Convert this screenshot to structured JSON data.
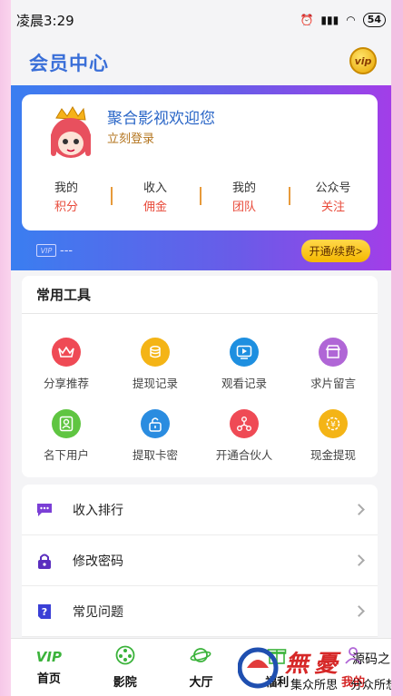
{
  "status": {
    "time": "凌晨3:29",
    "battery": "54"
  },
  "header": {
    "title": "会员中心",
    "vip_badge": "vip"
  },
  "profile": {
    "welcome": "聚合影视欢迎您",
    "login": "立刻登录",
    "stats": [
      {
        "top": "我的",
        "bottom": "积分"
      },
      {
        "top": "收入",
        "bottom": "佣金"
      },
      {
        "top": "我的",
        "bottom": "团队"
      },
      {
        "top": "公众号",
        "bottom": "关注"
      }
    ]
  },
  "vip": {
    "tag": "VIP",
    "status": "---",
    "renew": "开通/续费>"
  },
  "tools": {
    "title": "常用工具",
    "items": [
      {
        "label": "分享推荐",
        "icon": "crown-icon",
        "color": "#ef4a55"
      },
      {
        "label": "提现记录",
        "icon": "coins-icon",
        "color": "#f4b416"
      },
      {
        "label": "观看记录",
        "icon": "play-icon",
        "color": "#1e8fe0"
      },
      {
        "label": "求片留言",
        "icon": "shop-icon",
        "color": "#b066d6"
      },
      {
        "label": "名下用户",
        "icon": "user-card-icon",
        "color": "#5fc541"
      },
      {
        "label": "提取卡密",
        "icon": "lock-icon",
        "color": "#2a8ce0"
      },
      {
        "label": "开通合伙人",
        "icon": "network-icon",
        "color": "#ef4a55"
      },
      {
        "label": "现金提现",
        "icon": "coin-gear-icon",
        "color": "#f4b416"
      }
    ]
  },
  "menu": [
    {
      "label": "收入排行",
      "icon": "chat-icon",
      "color": "#7b3fd6"
    },
    {
      "label": "修改密码",
      "icon": "padlock-icon",
      "color": "#5b2fbf"
    },
    {
      "label": "常见问题",
      "icon": "question-icon",
      "color": "#3a3fd6"
    }
  ],
  "tabs": [
    {
      "label": "首页",
      "icon": "vip-icon"
    },
    {
      "label": "影院",
      "icon": "film-reel-icon"
    },
    {
      "label": "大厅",
      "icon": "planet-icon"
    },
    {
      "label": "福利",
      "icon": "gift-icon"
    },
    {
      "label": "我的",
      "icon": "profile-icon"
    }
  ],
  "watermark": {
    "main": "源码之家",
    "sub1": "集众所思",
    "sub2": "分众所想"
  }
}
